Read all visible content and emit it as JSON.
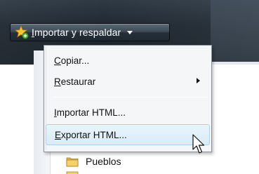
{
  "toolbar": {
    "button": {
      "mnemonic": "I",
      "label_rest": "mportar y respaldar",
      "icon": "star-plus-icon",
      "caret_icon": "dropdown-caret-icon"
    }
  },
  "menu": {
    "items": [
      {
        "mnemonic": "C",
        "label_rest": "opiar...",
        "submenu": false,
        "highlighted": false
      },
      {
        "mnemonic": "R",
        "label_rest": "estaurar",
        "submenu": true,
        "highlighted": false
      },
      {
        "mnemonic": "I",
        "label_rest": "mportar HTML...",
        "submenu": false,
        "highlighted": false
      },
      {
        "mnemonic": "E",
        "label_rest": "xportar HTML...",
        "submenu": false,
        "highlighted": true
      }
    ]
  },
  "tree": {
    "folder_label": "Pueblos",
    "folder_icon": "folder-icon"
  },
  "colors": {
    "toolbar_bg": "#1f2831",
    "menu_bg": "#f5f6f7",
    "highlight_border": "#a8d2ee",
    "folder_yellow": "#f2c14e"
  }
}
